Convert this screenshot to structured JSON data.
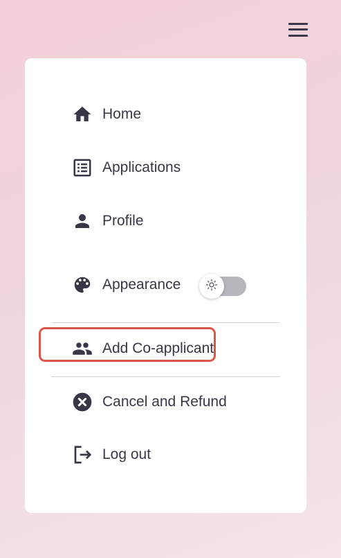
{
  "header": {
    "menu_icon": "hamburger-menu-icon"
  },
  "menu": {
    "items": [
      {
        "label": "Home",
        "icon": "home-icon"
      },
      {
        "label": "Applications",
        "icon": "list-icon"
      },
      {
        "label": "Profile",
        "icon": "person-icon"
      },
      {
        "label": "Appearance",
        "icon": "palette-icon"
      },
      {
        "label": "Add Co-applicant",
        "icon": "people-icon"
      },
      {
        "label": "Cancel and Refund",
        "icon": "cancel-circle-icon"
      },
      {
        "label": "Log out",
        "icon": "logout-icon"
      }
    ],
    "appearance_toggle": {
      "state": "off",
      "icon": "sun-icon"
    },
    "highlighted_item": "Cancel and Refund",
    "highlight_color": "#d9574a"
  },
  "colors": {
    "text": "#3b3548",
    "card": "#ffffff",
    "background": "#f2d2d8"
  }
}
